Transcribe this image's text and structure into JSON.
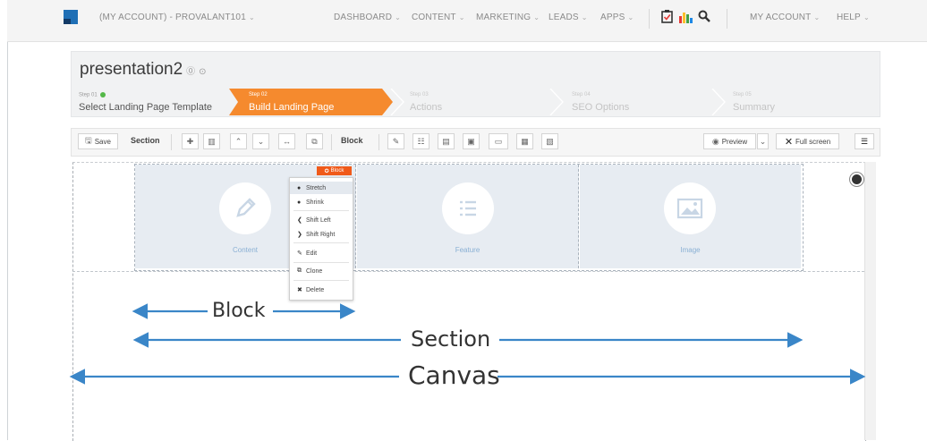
{
  "topnav": {
    "account": "(MY ACCOUNT) - PROVALANT101",
    "items": [
      "DASHBOARD",
      "CONTENT",
      "MARKETING",
      "LEADS",
      "APPS"
    ],
    "right": [
      "MY ACCOUNT",
      "HELP"
    ]
  },
  "page": {
    "title": "presentation2"
  },
  "steps": [
    {
      "num": "Step 01",
      "label": "Select Landing Page Template",
      "state": "done"
    },
    {
      "num": "Step 02",
      "label": "Build Landing Page",
      "state": "active"
    },
    {
      "num": "Step 03",
      "label": "Actions",
      "state": "todo"
    },
    {
      "num": "Step 04",
      "label": "SEO Options",
      "state": "todo"
    },
    {
      "num": "Step 05",
      "label": "Summary",
      "state": "todo"
    }
  ],
  "toolbar": {
    "save": "Save",
    "section": "Section",
    "block": "Block",
    "preview": "Preview",
    "fullscreen": "Full screen"
  },
  "blocks": [
    {
      "label": "Content",
      "icon": "pencil-icon"
    },
    {
      "label": "Feature",
      "icon": "list-icon"
    },
    {
      "label": "Image",
      "icon": "image-icon"
    }
  ],
  "block_menu": {
    "badge": "Block",
    "items": [
      "Stretch",
      "Shrink",
      "Shift Left",
      "Shift Right",
      "Edit",
      "Clone",
      "Delete"
    ]
  },
  "annotations": {
    "block": "Block",
    "section": "Section",
    "canvas": "Canvas"
  },
  "colors": {
    "accent_orange": "#f58a2e",
    "badge_red": "#f05a1a",
    "arrow_blue": "#3a86c8",
    "block_bg": "#e7ecf2"
  }
}
